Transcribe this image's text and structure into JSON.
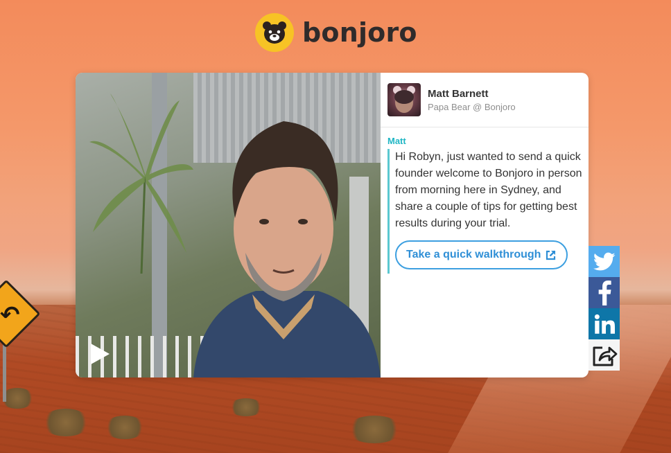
{
  "brand": {
    "name": "bonjoro",
    "logo_icon": "bear-face-icon",
    "logo_color": "#f7c325"
  },
  "video": {
    "play_icon": "play-icon"
  },
  "sender": {
    "name": "Matt Barnett",
    "title": "Papa Bear @ Bonjoro"
  },
  "message": {
    "from": "Matt",
    "body": "Hi Robyn, just wanted to send a quick founder welcome to Bonjoro in person from morning here in Sydney, and share a couple of tips for getting best results during your trial.",
    "cta_label": "Take a quick walkthrough",
    "cta_icon": "external-link-icon",
    "accent_color": "#1fb6c4",
    "cta_color": "#2f8fd6"
  },
  "share": [
    {
      "network": "twitter",
      "icon": "twitter-icon",
      "color": "#55acee"
    },
    {
      "network": "facebook",
      "icon": "facebook-icon",
      "color": "#3b5998"
    },
    {
      "network": "linkedin",
      "icon": "linkedin-icon",
      "color": "#0e76a8"
    },
    {
      "network": "share",
      "icon": "share-icon",
      "color": "#f5f5f5"
    }
  ]
}
